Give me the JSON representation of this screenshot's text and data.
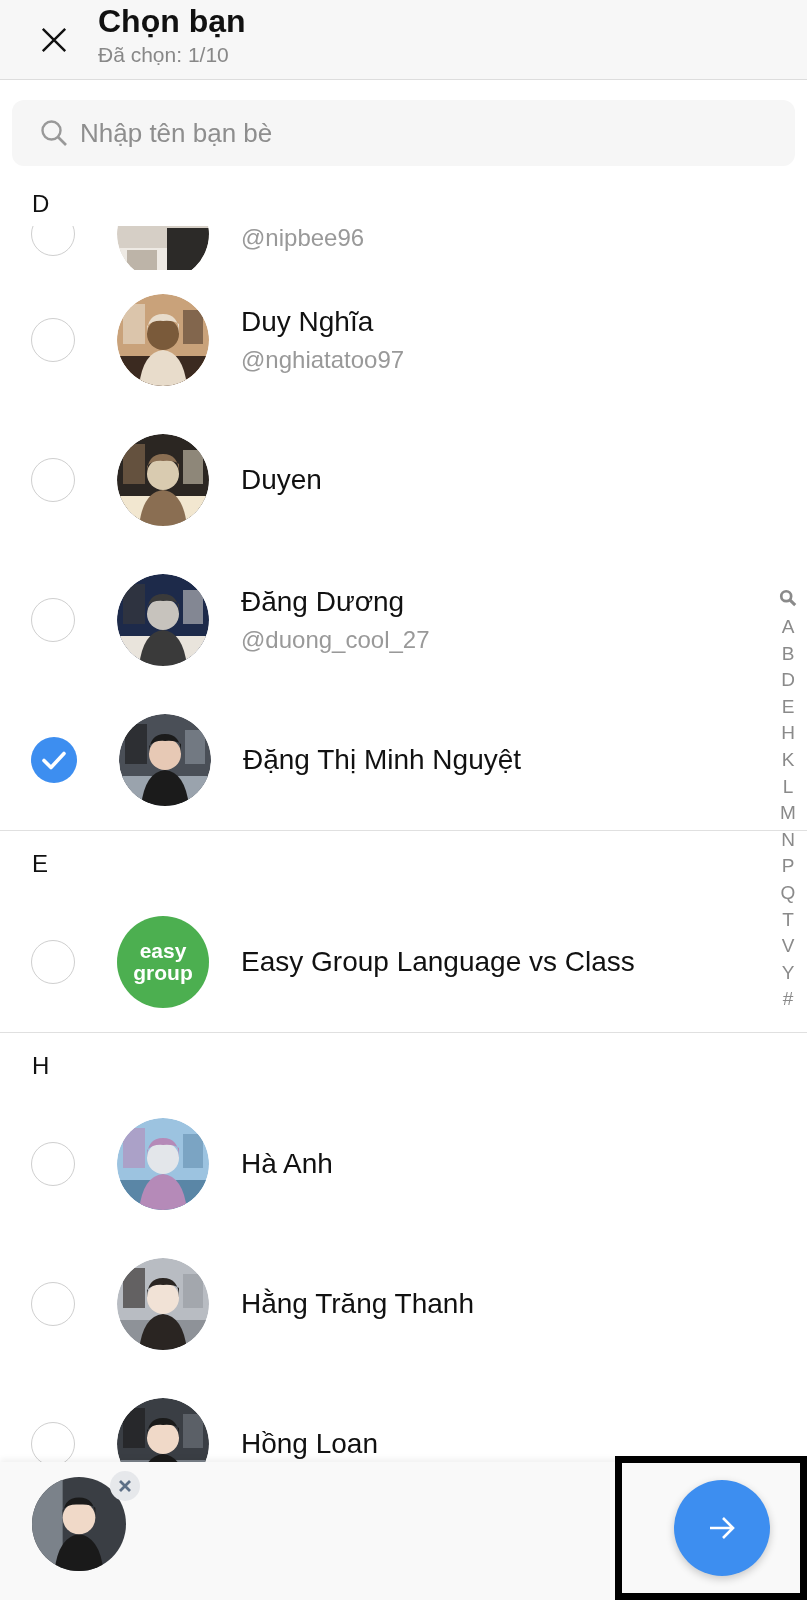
{
  "header": {
    "title": "Chọn bạn",
    "subtitle": "Đã chọn: 1/10"
  },
  "search": {
    "placeholder": "Nhập tên bạn bè"
  },
  "partial_row": {
    "handle": "@nipbee96",
    "checked": false
  },
  "sections": [
    {
      "letter": "D",
      "rows": [
        {
          "name": "Duy Nghĩa",
          "handle": "@nghiatatoo97",
          "checked": false
        },
        {
          "name": "Duyen",
          "checked": false
        },
        {
          "name": "Đăng Dương",
          "handle": "@duong_cool_27",
          "checked": false
        },
        {
          "name": "Đặng Thị Minh Nguyệt",
          "checked": true
        }
      ]
    },
    {
      "letter": "E",
      "rows": [
        {
          "name": "Easy Group  Language vs Class",
          "checked": false,
          "avatar": {
            "kind": "logo",
            "lines": [
              "easy",
              "group"
            ],
            "color": "#4caf50"
          }
        }
      ]
    },
    {
      "letter": "H",
      "rows": [
        {
          "name": "Hà Anh",
          "checked": false
        },
        {
          "name": "Hằng Trăng Thanh",
          "checked": false
        },
        {
          "name": "Hồng Loan",
          "checked": false
        }
      ]
    }
  ],
  "index_bar": [
    "A",
    "B",
    "D",
    "E",
    "H",
    "K",
    "L",
    "M",
    "N",
    "P",
    "Q",
    "T",
    "V",
    "Y",
    "#"
  ],
  "selected_chips": [
    {
      "removable": true
    }
  ],
  "send_button": {
    "highlighted": true
  }
}
